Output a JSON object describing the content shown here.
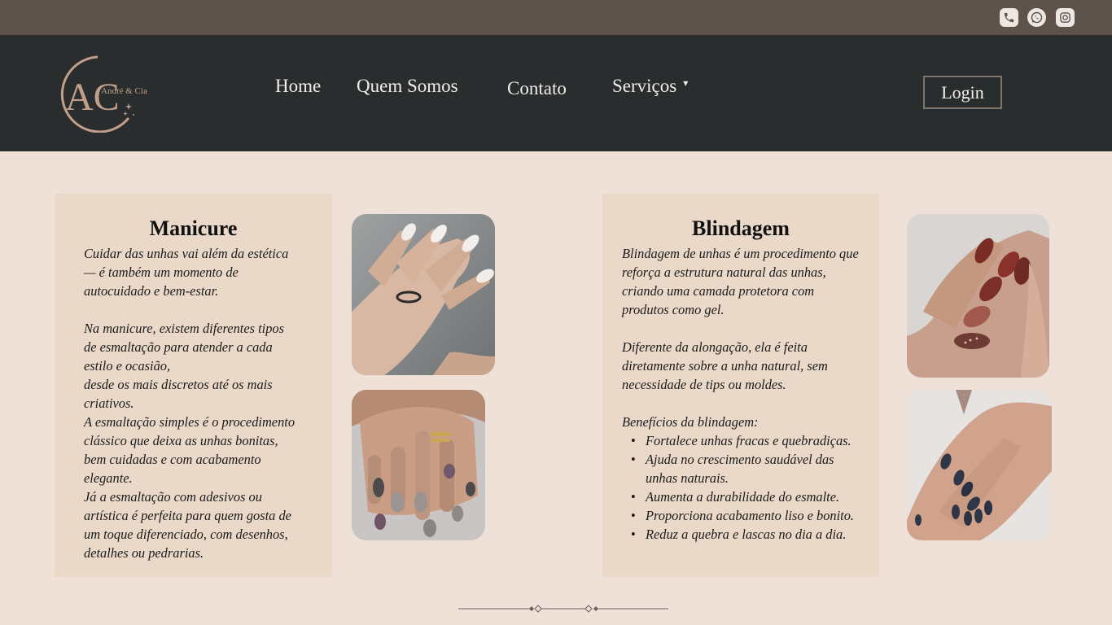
{
  "topbar": {
    "icons": [
      "phone-icon",
      "whatsapp-icon",
      "instagram-icon"
    ]
  },
  "logo": {
    "monogram": "AC",
    "brand": "André & Cia"
  },
  "nav": {
    "home": "Home",
    "about": "Quem Somos",
    "contact": "Contato",
    "services": "Serviços",
    "services_caret": "▾",
    "login": "Login"
  },
  "manicure": {
    "title": "Manicure",
    "paragraph1": "Cuidar das unhas vai além da estética\n— é também um momento de\nautocuidado e bem-estar.",
    "paragraph2": "Na manicure, existem diferentes tipos\nde esmaltação para atender a cada\nestilo e ocasião,\ndesde os mais discretos até os mais\ncriativos.\nA esmaltação simples é o procedimento\nclássico que deixa as unhas bonitas,\nbem cuidadas e com acabamento\nelegante.\n Já a esmaltação com adesivos ou\nartística é perfeita para quem gosta de\num toque diferenciado, com desenhos,\ndetalhes ou pedrarias."
  },
  "blindagem": {
    "title": "Blindagem",
    "paragraph1": "Blindagem de unhas é um procedimento que\nreforça a estrutura natural das unhas,\ncriando uma camada protetora com\nprodutos como gel.",
    "paragraph2": "Diferente da alongação, ela é feita\ndiretamente sobre a unha natural, sem\nnecessidade de tips ou moldes.",
    "benefits_title": "Benefícios da blindagem:",
    "benefits": [
      "Fortalece unhas fracas e quebradiças.",
      "Ajuda no crescimento saudável das\nunhas naturais.",
      "Aumenta a durabilidade do esmalte.",
      "Proporciona acabamento liso e bonito.",
      "Reduz a quebra e lascas no dia a dia."
    ]
  },
  "colors": {
    "topbar": "#5d534a",
    "header": "#292d2d",
    "page": "#efe1d8",
    "card": "#ead9c8",
    "logo_accent": "#c19f8a"
  }
}
